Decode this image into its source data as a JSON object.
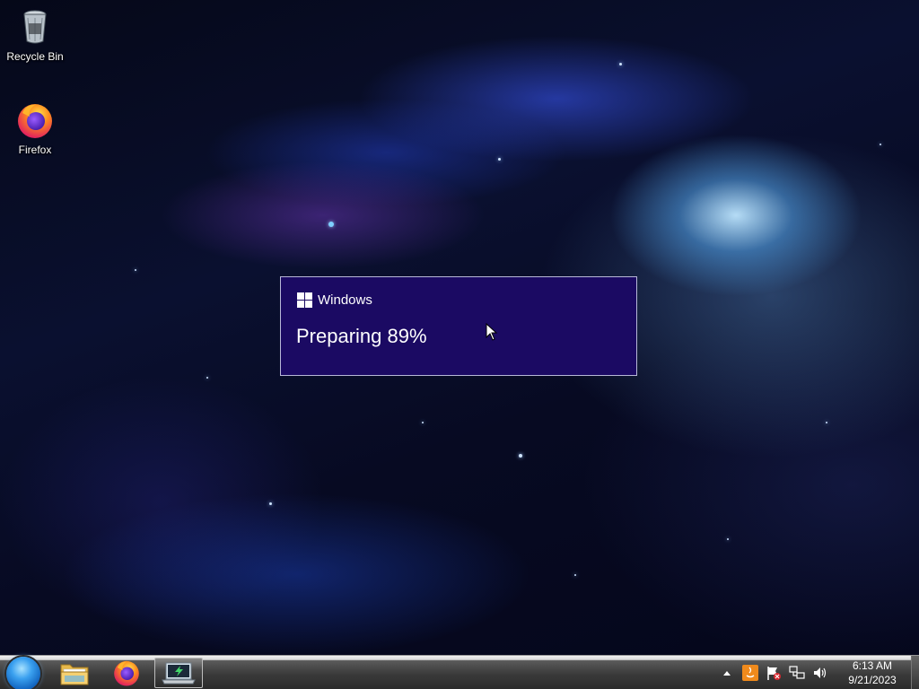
{
  "desktop": {
    "icons": [
      {
        "label": "Recycle Bin",
        "icon": "recycle-bin-icon"
      },
      {
        "label": "Firefox",
        "icon": "firefox-icon"
      }
    ]
  },
  "dialog": {
    "brand": "Windows",
    "status": "Preparing 89%",
    "progress_percent": 89,
    "background_color": "#1b0a63"
  },
  "taskbar": {
    "start_button": "start-orb-icon",
    "pinned": [
      {
        "app": "File Explorer",
        "icon": "folder-icon"
      },
      {
        "app": "Firefox",
        "icon": "firefox-icon"
      },
      {
        "app": "Windows Upgrade",
        "icon": "upgrade-laptop-icon",
        "active": true
      }
    ],
    "tray": {
      "icons": [
        "show-hidden-icons-chevron-icon",
        "java-update-icon",
        "action-center-flag-icon",
        "network-icon",
        "volume-icon"
      ],
      "time": "6:13 AM",
      "date": "9/21/2023"
    }
  }
}
